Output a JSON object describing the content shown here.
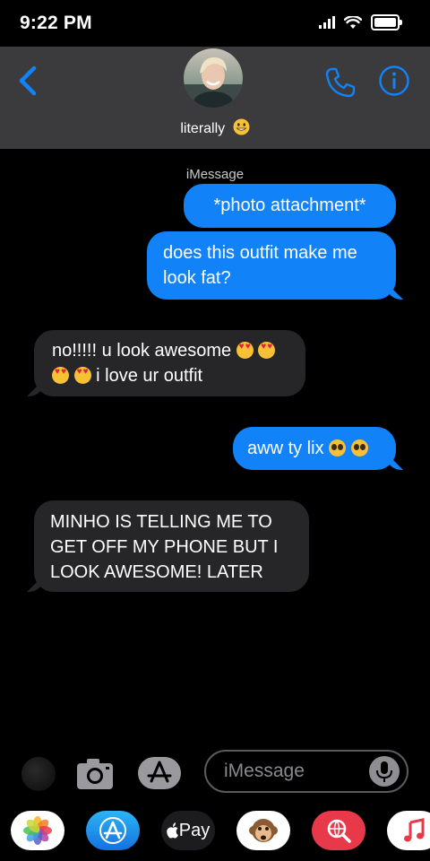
{
  "status_bar": {
    "time": "9:22 PM"
  },
  "header": {
    "back_icon": "chevron-left-icon",
    "contact_name": "literally",
    "contact_emoji": "grinning-face-icon",
    "phone_icon": "phone-icon",
    "info_icon": "info-icon"
  },
  "thread": {
    "service_label": "iMessage",
    "messages": [
      {
        "direction": "outgoing",
        "text": "*photo attachment*"
      },
      {
        "direction": "outgoing",
        "text": "does this outfit make me look fat?"
      },
      {
        "direction": "incoming",
        "text_line1": "no!!!!! u look awesome",
        "text_line2": "i love ur outfit"
      },
      {
        "direction": "outgoing",
        "text": "aww ty lix"
      },
      {
        "direction": "incoming",
        "text": "MINHO IS TELLING ME TO GET OFF MY PHONE BUT I LOOK AWESOME! LATER"
      }
    ]
  },
  "composer": {
    "placeholder": "iMessage",
    "effects_icon": "effects-icon",
    "camera_icon": "camera-icon",
    "apps_icon": "app-store-icon",
    "mic_icon": "microphone-icon"
  },
  "app_drawer": {
    "items": [
      {
        "name": "photos-icon"
      },
      {
        "name": "app-store-icon"
      },
      {
        "name": "apple-pay",
        "label": "Pay"
      },
      {
        "name": "animoji-icon"
      },
      {
        "name": "web-search-icon"
      },
      {
        "name": "music-icon"
      }
    ]
  },
  "colors": {
    "accent": "#1182f8",
    "incoming_bubble": "#262628",
    "header_bg": "#3b3b3d",
    "background": "#000000"
  }
}
